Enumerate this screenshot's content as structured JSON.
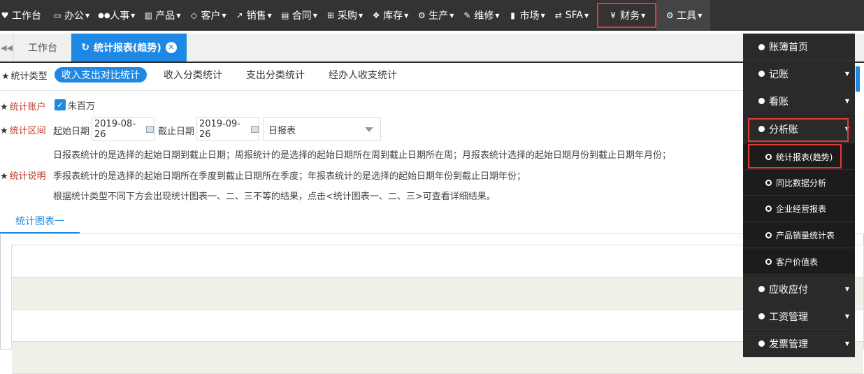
{
  "nav": {
    "items": [
      {
        "icon": "heart-icon",
        "glyph": "♥",
        "label": "工作台",
        "caret": false
      },
      {
        "icon": "monitor-icon",
        "glyph": "▭",
        "label": "办公",
        "caret": true
      },
      {
        "icon": "users-icon",
        "glyph": "👥",
        "label": "人事",
        "caret": true
      },
      {
        "icon": "barcode-icon",
        "glyph": "▥",
        "label": "产品",
        "caret": true
      },
      {
        "icon": "diamond-icon",
        "glyph": "◇",
        "label": "客户",
        "caret": true
      },
      {
        "icon": "line-chart-icon",
        "glyph": "↗",
        "label": "销售",
        "caret": true
      },
      {
        "icon": "contract-icon",
        "glyph": "▤",
        "label": "合同",
        "caret": true
      },
      {
        "icon": "cart-icon",
        "glyph": "⊞",
        "label": "采购",
        "caret": true
      },
      {
        "icon": "cubes-icon",
        "glyph": "❖",
        "label": "库存",
        "caret": true
      },
      {
        "icon": "cogs-icon",
        "glyph": "⚙",
        "label": "生产",
        "caret": true
      },
      {
        "icon": "wrench-icon",
        "glyph": "🔧",
        "label": "维修",
        "caret": true
      },
      {
        "icon": "bookmark-icon",
        "glyph": "▮",
        "label": "市场",
        "caret": true
      },
      {
        "icon": "retweet-icon",
        "glyph": "⇄",
        "label": "SFA",
        "caret": true
      },
      {
        "icon": "yen-icon",
        "glyph": "¥",
        "label": "财务",
        "caret": true
      },
      {
        "icon": "gear-icon",
        "glyph": "⚙",
        "label": "工具",
        "caret": true
      }
    ]
  },
  "tabs": {
    "back_glyph": "◀◀",
    "home": "工作台",
    "active": "统计报表(趋势)",
    "close_glyph": "✕"
  },
  "stats_type": {
    "label": "统计类型",
    "options": [
      "收入支出对比统计",
      "收入分类统计",
      "支出分类统计",
      "经办人收支统计"
    ],
    "selected": "收入支出对比统计"
  },
  "account": {
    "label": "统计账户",
    "checkbox_glyph": "✓",
    "value": "朱百万"
  },
  "range": {
    "label": "统计区间",
    "start_label": "起始日期",
    "start_value": "2019-08-26",
    "end_label": "截止日期",
    "end_value": "2019-09-26",
    "period": "日报表"
  },
  "explain": {
    "label": "统计说明",
    "lines": [
      "日报表统计的是选择的起始日期到截止日期；周报统计的是选择的起始日期所在周到截止日期所在周；月报表统计选择的起始日期月份到截止日期年月份；",
      "季报表统计的是选择的起始日期所在季度到截止日期所在季度；年报表统计的是选择的起始日期年份到截止日期年份；",
      "根据统计类型不同下方会出现统计图表一、二、三不等的结果，点击<统计图表一、二、三>可查看详细结果。"
    ]
  },
  "chart_tab": "统计图表一",
  "finance_menu": {
    "items": [
      {
        "label": "账簿首页",
        "chevron": false
      },
      {
        "label": "记账",
        "chevron": true
      },
      {
        "label": "看账",
        "chevron": true
      },
      {
        "label": "分析账",
        "chevron": true
      }
    ],
    "sub_items": [
      "统计报表(趋势)",
      "同比数据分析",
      "企业经营报表",
      "产品销量统计表",
      "客户价值表"
    ],
    "after_items": [
      {
        "label": "应收应付",
        "chevron": true
      },
      {
        "label": "工资管理",
        "chevron": true
      },
      {
        "label": "发票管理",
        "chevron": true
      }
    ]
  },
  "colors": {
    "accent": "#1e88e5",
    "nav_bg": "#333333",
    "highlight": "#e53935"
  }
}
